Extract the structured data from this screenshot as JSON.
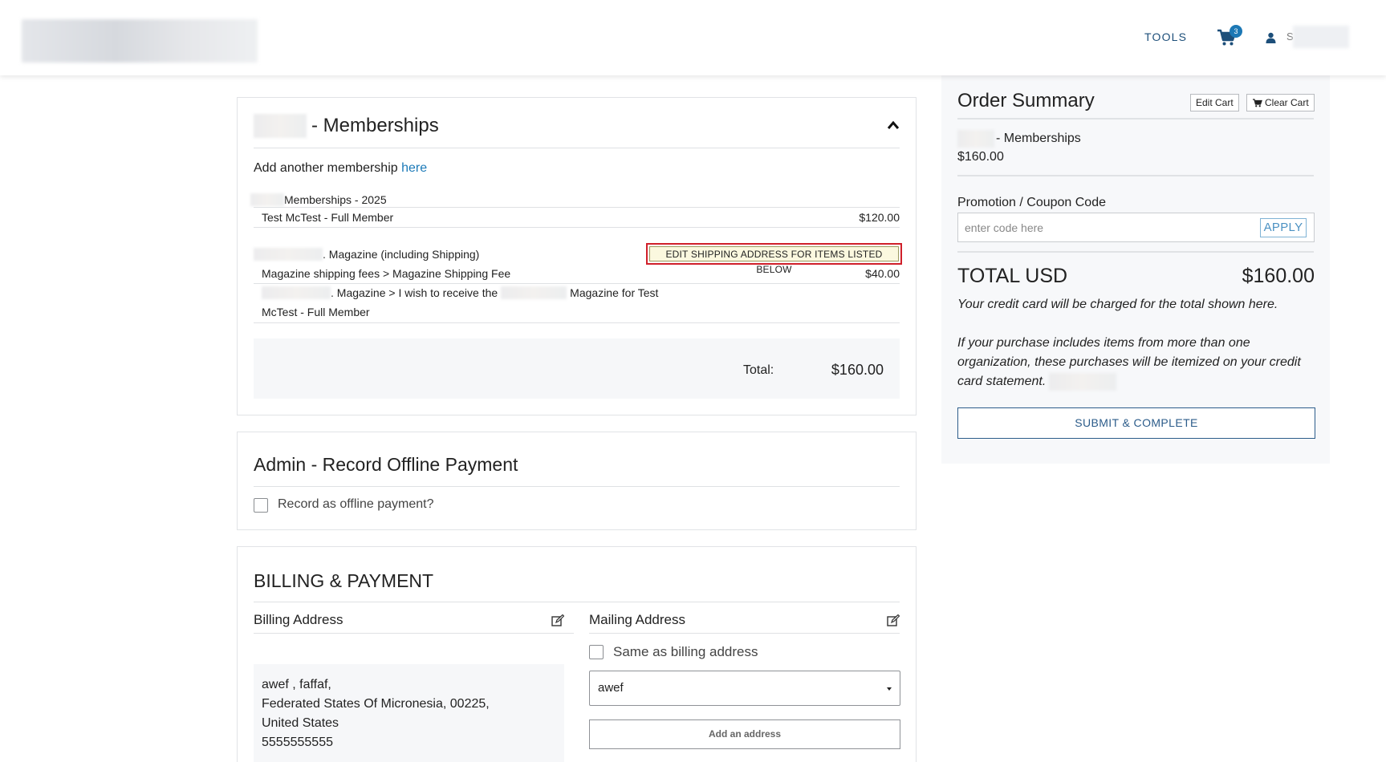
{
  "header": {
    "tools_label": "TOOLS",
    "cart_count": "3",
    "user_initial": "S"
  },
  "memberships": {
    "title_suffix": "- Memberships",
    "add_another_prefix": "Add another membership ",
    "add_another_link": "here",
    "group1_title": "Memberships - 2025",
    "line1_label": "Test McTest - Full Member",
    "line1_amount": "$120.00",
    "group2_title": ". Magazine (including Shipping)",
    "edit_shipping_label": "EDIT SHIPPING ADDRESS FOR ITEMS LISTED BELOW",
    "line2_label": "Magazine shipping fees > Magazine Shipping Fee",
    "line2_amount": "$40.00",
    "line3_part1": ". Magazine > I wish to receive the",
    "line3_part2": "Magazine for Test",
    "line3_part3": "McTest - Full Member",
    "total_label": "Total:",
    "total_value": "$160.00"
  },
  "admin": {
    "title": "Admin - Record Offline Payment",
    "offline_label": "Record as offline payment?",
    "offline_checked": false
  },
  "billing": {
    "title": "BILLING & PAYMENT",
    "billing_address_label": "Billing Address",
    "mailing_address_label": "Mailing Address",
    "billing_lines": [
      "awef , faffaf,",
      "Federated States Of Micronesia, 00225,",
      "United States",
      "5555555555"
    ],
    "same_as_billing_label": "Same as billing address",
    "same_as_billing_checked": false,
    "mailing_select_value": "awef",
    "add_address_label": "Add an address"
  },
  "summary": {
    "title": "Order Summary",
    "edit_cart_label": "Edit Cart",
    "clear_cart_label": "Clear Cart",
    "item_suffix": "- Memberships",
    "item_price": "$160.00",
    "promo_label": "Promotion / Coupon Code",
    "promo_placeholder": "enter code here",
    "apply_label": "APPLY",
    "total_label": "TOTAL USD",
    "total_value": "$160.00",
    "charge_note": "Your credit card will be charged for the total shown here.",
    "itemize_note": "If your purchase includes items from more than one organization, these purchases will be itemized on your credit card statement.",
    "submit_label": "SUBMIT & COMPLETE"
  },
  "colors": {
    "accent_blue": "#1c7ab8",
    "nav_blue": "#1d4f7a",
    "highlight_red": "#d0202a",
    "highlight_fill": "#fbf8df"
  },
  "icons": [
    "cart-icon",
    "user-icon",
    "chevron-up-icon",
    "edit-icon",
    "cart-small-icon",
    "caret-down-icon"
  ]
}
